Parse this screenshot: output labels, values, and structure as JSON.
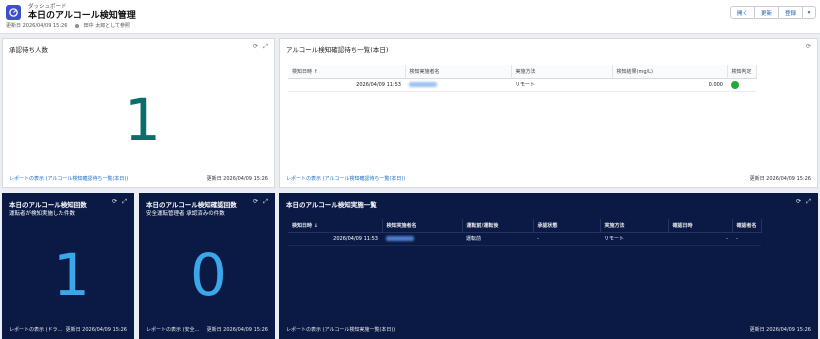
{
  "header": {
    "eyebrow": "ダッシュボード",
    "title": "本日のアルコール検知管理",
    "updated": "更新日 2026/04/09 15:26",
    "viewing_as": "田中 太郎として参照",
    "buttons": {
      "open": "開く",
      "refresh": "更新",
      "subscribe": "登録"
    }
  },
  "cards": {
    "pending": {
      "title": "承認待ち人数",
      "value": "1",
      "link": "レポートの表示 (アルコール検知確認待ち一覧(本日))",
      "date": "更新日 2026/04/09 15:26"
    },
    "pending_list": {
      "title": "アルコール検知確認待ち一覧(本日)",
      "columns": [
        "検知日時 ↑",
        "検知実施者名",
        "実施方法",
        "検知結果(mg/L)",
        "検知判定"
      ],
      "rows": [
        {
          "datetime": "2026/04/09 11:53",
          "method": "リモート",
          "result": "0.000"
        }
      ],
      "link": "レポートの表示 (アルコール検知確認待ち一覧(本日))",
      "date": "更新日 2026/04/09 15:26"
    },
    "detect_count": {
      "title": "本日のアルコール検知回数",
      "subtitle": "運転者が検知実施した件数",
      "value": "1",
      "link": "レポートの表示 (ドラ…",
      "date": "更新日 2026/04/09 15:26"
    },
    "confirm_count": {
      "title": "本日のアルコール検知確認回数",
      "subtitle": "安全運転管理者 承認済みの件数",
      "value": "0",
      "link": "レポートの表示 (安全…",
      "date": "更新日 2026/04/09 15:26"
    },
    "done_list": {
      "title": "本日のアルコール検知実施一覧",
      "columns": [
        "検知日時 ↓",
        "検知実施者名",
        "運転前/運転後",
        "承認状態",
        "実施方法",
        "確認日時",
        "確認者名"
      ],
      "rows": [
        {
          "datetime": "2026/04/09 11:53",
          "phase": "運転前",
          "approval": "-",
          "method": "リモート",
          "confirmed_at": "-",
          "confirmer": "-"
        }
      ],
      "link": "レポートの表示 (アルコール検知実施一覧(本日))",
      "date": "更新日 2026/04/09 15:26"
    }
  },
  "colors": {
    "accent": "#3b4fd0",
    "dark_panel": "#0b1a45",
    "teal_value": "#0b6e6b",
    "blue_value": "#3aa7e8",
    "ok_green": "#1faa3a"
  }
}
